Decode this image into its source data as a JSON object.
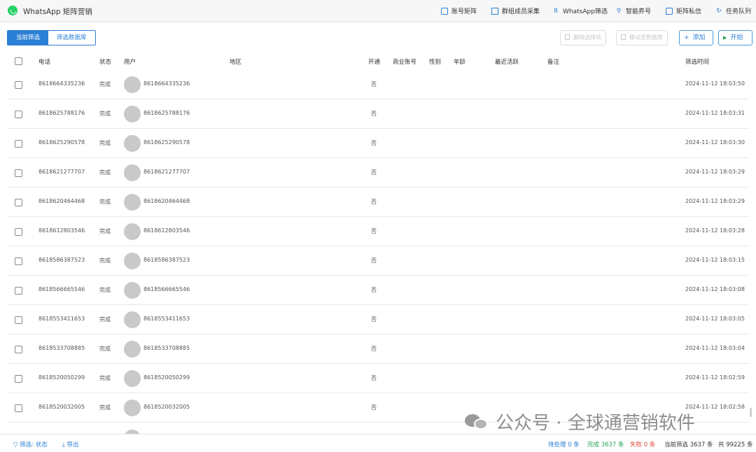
{
  "app": {
    "title": "WhatsApp 矩阵营销"
  },
  "nav": [
    {
      "label": "账号矩阵",
      "icon": "account-matrix-icon"
    },
    {
      "label": "群组成员采集",
      "icon": "group-collect-icon"
    },
    {
      "label": "WhatsApp筛选",
      "icon": "filter-icon"
    },
    {
      "label": "智能养号",
      "icon": "bike-icon"
    },
    {
      "label": "矩阵私信",
      "icon": "message-icon"
    },
    {
      "label": "任务队列",
      "icon": "queue-icon"
    }
  ],
  "tabs": [
    {
      "label": "当前筛选",
      "active": true
    },
    {
      "label": "筛选数据库",
      "active": false
    }
  ],
  "toolbar": {
    "remove_label": "删除选择项",
    "move_label": "移动至数据库",
    "add_label": "添加",
    "start_label": "开始"
  },
  "table": {
    "columns": [
      "电话",
      "状态",
      "用户",
      "地区",
      "开通",
      "商业账号",
      "性别",
      "年龄",
      "最近活跃",
      "备注",
      "筛选时间"
    ],
    "rows": [
      {
        "phone": "8618664335236",
        "status": "完成",
        "user": "8618664335236",
        "opened": "否",
        "time": "2024-11-12 18:03:50"
      },
      {
        "phone": "8618625788176",
        "status": "完成",
        "user": "8618625788176",
        "opened": "否",
        "time": "2024-11-12 18:03:31"
      },
      {
        "phone": "8618625290578",
        "status": "完成",
        "user": "8618625290578",
        "opened": "否",
        "time": "2024-11-12 18:03:30"
      },
      {
        "phone": "8618621277707",
        "status": "完成",
        "user": "8618621277707",
        "opened": "否",
        "time": "2024-11-12 18:03:29"
      },
      {
        "phone": "8618620464468",
        "status": "完成",
        "user": "8618620464468",
        "opened": "否",
        "time": "2024-11-12 18:03:29"
      },
      {
        "phone": "8618612803546",
        "status": "完成",
        "user": "8618612803546",
        "opened": "否",
        "time": "2024-11-12 18:03:28"
      },
      {
        "phone": "8618586387523",
        "status": "完成",
        "user": "8618586387523",
        "opened": "否",
        "time": "2024-11-12 18:03:15"
      },
      {
        "phone": "8618566665546",
        "status": "完成",
        "user": "8618566665546",
        "opened": "否",
        "time": "2024-11-12 18:03:08"
      },
      {
        "phone": "8618553411653",
        "status": "完成",
        "user": "8618553411653",
        "opened": "否",
        "time": "2024-11-12 18:03:05"
      },
      {
        "phone": "8618533708885",
        "status": "完成",
        "user": "8618533708885",
        "opened": "否",
        "time": "2024-11-12 18:03:04"
      },
      {
        "phone": "8618520050299",
        "status": "完成",
        "user": "8618520050299",
        "opened": "否",
        "time": "2024-11-12 18:02:59"
      },
      {
        "phone": "8618520032005",
        "status": "完成",
        "user": "8618520032005",
        "opened": "否",
        "time": "2024-11-12 18:02:58"
      }
    ]
  },
  "footer": {
    "filter_label": "筛选: 状态",
    "export_label": "导出",
    "pending": "待处理 0 条",
    "done": "完成 3637 条",
    "failed": "失败 0 条",
    "current": "当前筛选 3637 条",
    "total": "共 99225 条"
  },
  "watermark": {
    "text": "公众号 · 全球通营销软件"
  },
  "colors": {
    "accent": "#2b7fd4",
    "success": "#25a35a",
    "danger": "#e0493c",
    "whatsapp": "#25d366"
  }
}
